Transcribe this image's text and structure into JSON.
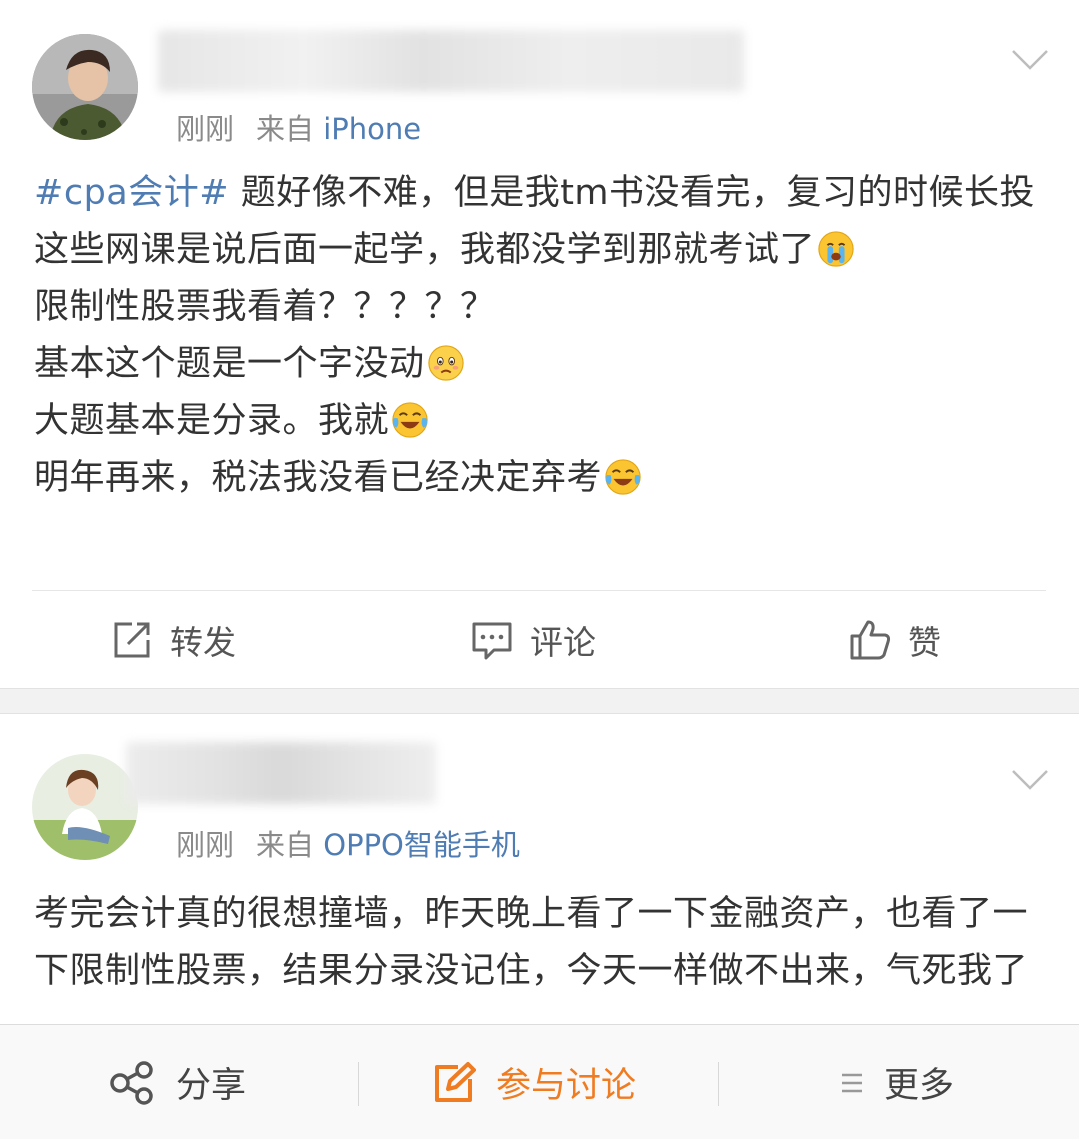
{
  "posts": [
    {
      "time": "刚刚",
      "from_prefix": "来自",
      "source": "iPhone",
      "topic": "#cpa会计#",
      "lines": [
        " 题好像不难，但是我tm书没看完，复习的时候长投这些网课是说后面一起学，我都没学到那就考试了",
        "限制性股票我看着？？？？？",
        "基本这个题是一个字没动",
        "大题基本是分录。我就",
        "明年再来，税法我没看已经决定弃考"
      ],
      "emojis": [
        "crying-face-emoji",
        "sad-face-emoji",
        "laughing-tears-emoji",
        "laughing-tears-emoji"
      ],
      "actions": {
        "repost": "转发",
        "comment": "评论",
        "like": "赞"
      }
    },
    {
      "time": "刚刚",
      "from_prefix": "来自",
      "source": "OPPO智能手机",
      "text": "考完会计真的很想撞墙，昨天晚上看了一下金融资产，也看了一下限制性股票，结果分录没记住，今天一样做不出来，气死我了"
    }
  ],
  "bottom_bar": {
    "share": "分享",
    "discuss": "参与讨论",
    "more": "更多"
  },
  "colors": {
    "link": "#4f7db3",
    "highlight": "#f07c22",
    "meta": "#8a8a8a"
  }
}
